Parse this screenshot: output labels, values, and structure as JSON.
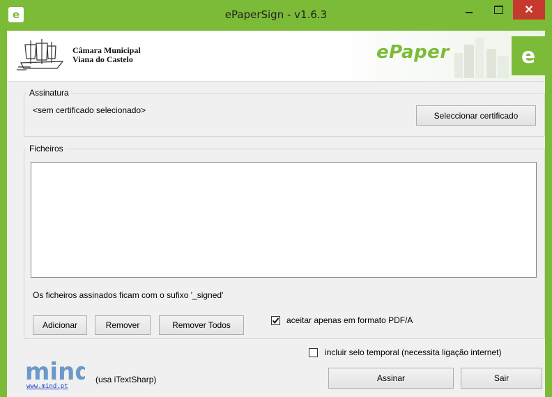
{
  "window": {
    "title": "ePaperSign - v1.6.3",
    "app_icon_letter": "e",
    "accent": "#7cbb38",
    "close_glyph": "✕"
  },
  "banner": {
    "org_line1": "Câmara Municipal",
    "org_line2": "Viana do Castelo",
    "brand": "ePaper",
    "brand_tile_letter": "e"
  },
  "signature": {
    "legend": "Assinatura",
    "status": "<sem certificado selecionado>",
    "select_button": "Seleccionar certificado"
  },
  "files": {
    "legend": "Ficheiros",
    "items": [],
    "note": "Os ficheiros assinados ficam com o sufixo '_signed'",
    "add_button": "Adicionar",
    "remove_button": "Remover",
    "remove_all_button": "Remover Todos",
    "pdfa_checkbox": {
      "label": "aceitar apenas em formato PDF/A",
      "checked": true
    }
  },
  "timestamp_checkbox": {
    "label": "incluir selo temporal (necessita ligação internet)",
    "checked": false
  },
  "footer": {
    "logo_text": "mind",
    "link": "www.mind.pt",
    "credit": "(usa iTextSharp)",
    "sign_button": "Assinar",
    "exit_button": "Sair"
  }
}
